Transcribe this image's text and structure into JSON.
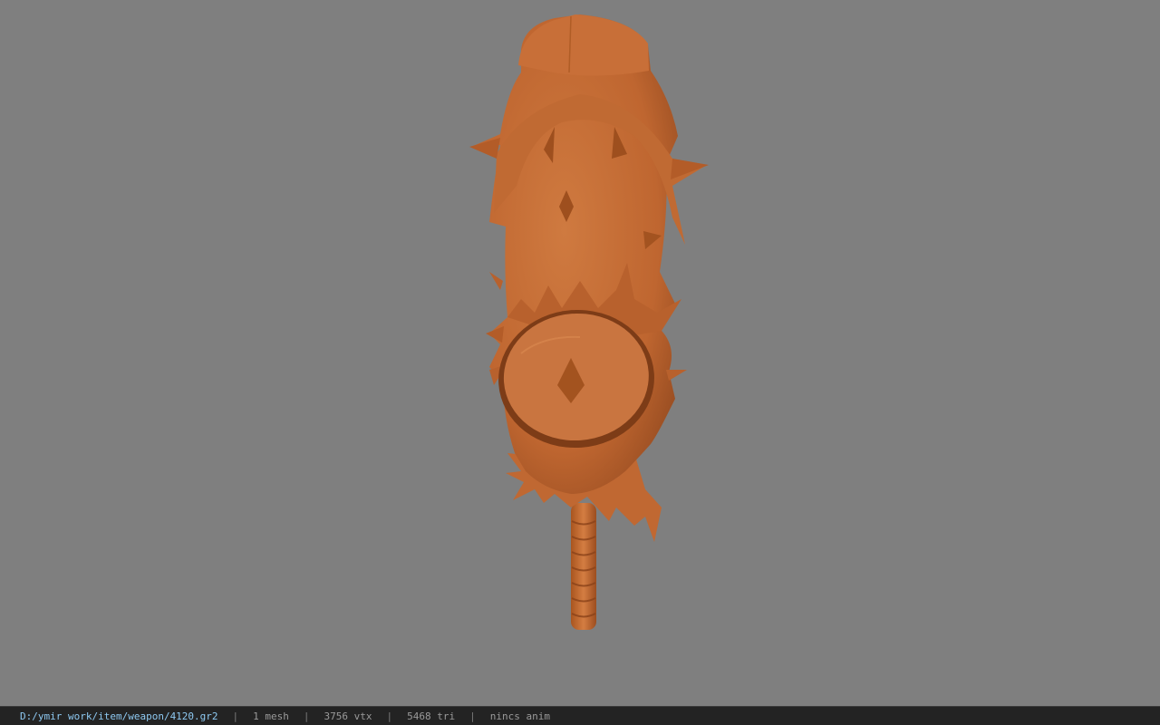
{
  "viewer": {
    "background_color": "#7f7f7f",
    "model_color": "#c46a32",
    "model_icon": "spiked-club-model"
  },
  "status": {
    "file_path": "D:/ymir work/item/weapon/4120.gr2",
    "mesh": "1 mesh",
    "vertices": "3756 vtx",
    "triangles": "5468 tri",
    "animation": "nincs anim",
    "separator": "|"
  }
}
